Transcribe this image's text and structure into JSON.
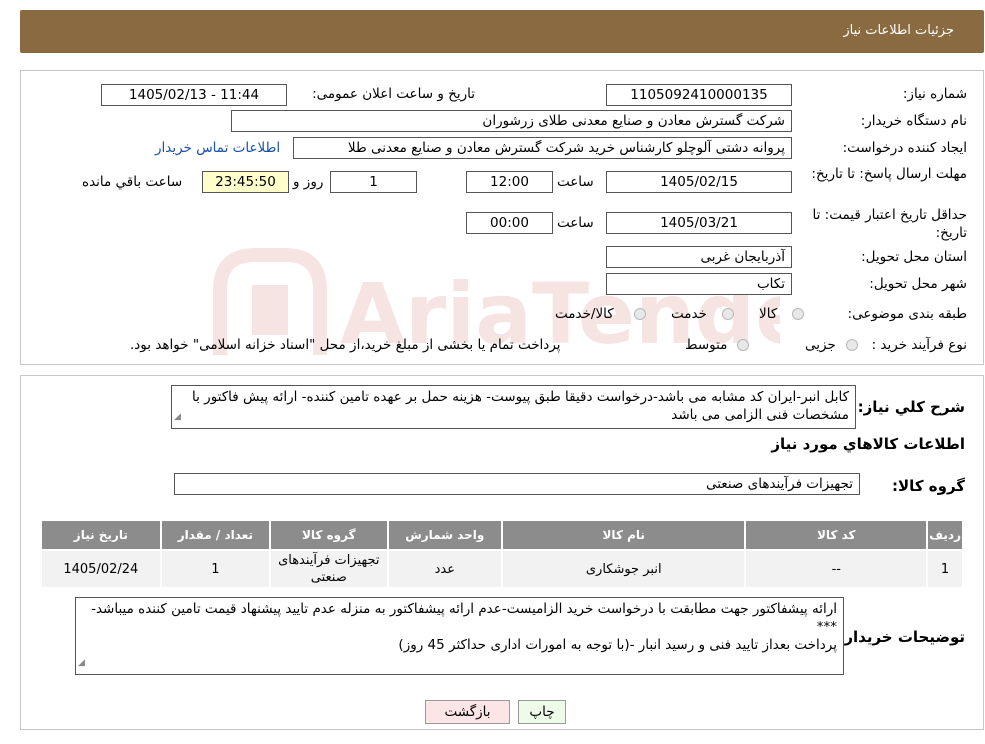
{
  "header": {
    "title": "جزئیات اطلاعات نیاز"
  },
  "fields": {
    "need_number_label": "شماره نیاز:",
    "need_number": "1105092410000135",
    "announce_label": "تاریخ و ساعت اعلان عمومی:",
    "announce_value": "1405/02/13 - 11:44",
    "buyer_org_label": "نام دستگاه خریدار:",
    "buyer_org": "شرکت گسترش معادن و صنایع معدنی طلای زرشوران",
    "requester_label": "ایجاد کننده درخواست:",
    "requester": "پروانه  دشتی آلوچلو کارشناس خرید شرکت گسترش معادن و صنایع معدنی طلا",
    "contact_link": "اطلاعات تماس خریدار",
    "deadline_label": "مهلت ارسال پاسخ: تا تاریخ:",
    "deadline_date": "1405/02/15",
    "time_label": "ساعت",
    "deadline_time": "12:00",
    "days_value": "1",
    "days_label": "روز و",
    "remaining_value": "23:45:50",
    "remaining_label": "ساعت باقي مانده",
    "validity_label": "حداقل تاریخ اعتبار قیمت: تا تاریخ:",
    "validity_date": "1405/03/21",
    "validity_time": "00:00",
    "province_label": "استان محل تحویل:",
    "province": "آذربایجان غربی",
    "city_label": "شهر محل تحویل:",
    "city": "تکاب",
    "category_label": "طبقه بندی موضوعی:",
    "category_options": [
      "کالا",
      "خدمت",
      "کالا/خدمت"
    ],
    "process_label": "نوع فرآیند خرید :",
    "process_options": [
      "جزیی",
      "متوسط"
    ],
    "process_note": "پرداخت تمام یا بخشی از مبلغ خرید،از محل \"اسناد خزانه اسلامی\" خواهد بود."
  },
  "description": {
    "label": "شرح کلي نياز:",
    "text": "کابل انبر-ایران کد مشابه می باشد-درخواست دقیقا طبق پیوست- هزینه حمل بر عهده تامین کننده- ارائه پیش فاکتور با مشخصات فنی الزامی می باشد"
  },
  "goods": {
    "section_title": "اطلاعات کالاهاي مورد نياز",
    "group_label": "گروه کالا:",
    "group_value": "تجهیزات فرآیندهای صنعتی",
    "columns": [
      "رديف",
      "کد کالا",
      "نام کالا",
      "واحد شمارش",
      "گروه کالا",
      "تعداد / مقدار",
      "تاریخ نیاز"
    ],
    "rows": [
      [
        "1",
        "--",
        "انبر جوشکاری",
        "عدد",
        "تجهیزات فرآیندهای صنعتی",
        "1",
        "1405/02/24"
      ]
    ]
  },
  "buyer_notes": {
    "label": "توضیحات خریدار:",
    "line1": "ارائه پیشفاکتور جهت مطابقت با درخواست خرید الزامیست-عدم ارائه پیشفاکتور به منزله عدم تایید پیشنهاد قیمت تامین کننده میباشد-***",
    "line2": "پرداخت بعداز تایید فنی و رسید انبار -(با توجه به امورات اداری حداکثر 45 روز)"
  },
  "buttons": {
    "print": "چاپ",
    "back": "بازگشت"
  },
  "watermark": {
    "text": "AriaTender.neT"
  },
  "colors": {
    "header": "#8a6b41",
    "table_header": "#8c8c8c",
    "watermark": "#c0392b"
  }
}
